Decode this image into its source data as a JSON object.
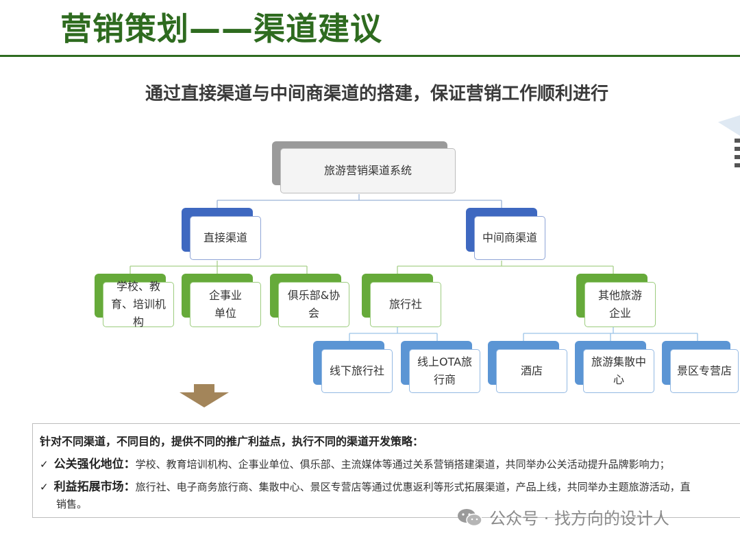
{
  "header": {
    "title": "营销策划——渠道建议",
    "subtitle": "通过直接渠道与中间商渠道的搭建，保证营销工作顺利进行"
  },
  "diagram": {
    "root": "旅游营销渠道系统",
    "direct": {
      "label": "直接渠道",
      "children": [
        "学校、教育、培训机构",
        "企事业单位",
        "俱乐部&协会"
      ]
    },
    "intermediary": {
      "label": "中间商渠道",
      "travel_agency": {
        "label": "旅行社",
        "children": [
          "线下旅行社",
          "线上OTA旅行商"
        ]
      },
      "other_enterprises": {
        "label": "其他旅游企业",
        "children": [
          "酒店",
          "旅游集散中心",
          "景区专营店"
        ]
      }
    }
  },
  "strategy": {
    "heading": "针对不同渠道，不同目的，提供不同的推广利益点，执行不同的渠道开发策略：",
    "check_mark": "✓",
    "items": [
      {
        "label": "公关强化地位：",
        "text": "学校、教育培训机构、企事业单位、俱乐部、主流媒体等通过关系营销搭建渠道，共同举办公关活动提升品牌影响力；"
      },
      {
        "label": "利益拓展市场：",
        "text": "旅行社、电子商务旅行商、集散中心、景区专营店等通过优惠返利等形式拓展渠道，产品上线，共同举办主题旅游活动，直",
        "continuation": "销售。"
      }
    ]
  },
  "watermark": {
    "text": "公众号 · 找方向的设计人",
    "icon": "wechat-icon"
  },
  "colors": {
    "title_green": "#2e6b1f",
    "level1_blue": "#3e68c0",
    "level2_green": "#66aa3a",
    "level3_blue": "#5b95d4",
    "arrow_brown": "#a3855a"
  }
}
